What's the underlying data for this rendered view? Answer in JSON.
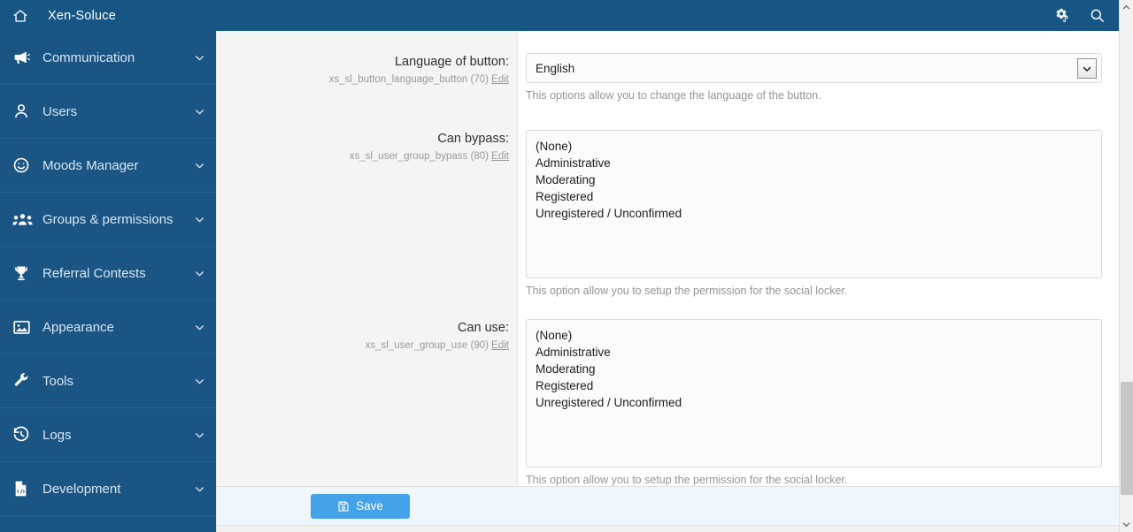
{
  "topbar": {
    "home_icon": "home-icon",
    "title": "Xen-Soluce",
    "gears_icon": "gears-icon",
    "search_icon": "search-icon"
  },
  "sidebar": {
    "items": [
      {
        "label": "Communication",
        "icon": "megaphone-icon",
        "chevron": "chevron-down-icon"
      },
      {
        "label": "Users",
        "icon": "user-icon",
        "chevron": "chevron-down-icon"
      },
      {
        "label": "Moods Manager",
        "icon": "smiley-icon",
        "chevron": "chevron-down-icon"
      },
      {
        "label": "Groups & permissions",
        "icon": "users-group-icon",
        "chevron": "chevron-down-icon"
      },
      {
        "label": "Referral Contests",
        "icon": "trophy-icon",
        "chevron": "chevron-down-icon"
      },
      {
        "label": "Appearance",
        "icon": "image-icon",
        "chevron": "chevron-down-icon"
      },
      {
        "label": "Tools",
        "icon": "wrench-icon",
        "chevron": "chevron-down-icon"
      },
      {
        "label": "Logs",
        "icon": "history-icon",
        "chevron": "chevron-down-icon"
      },
      {
        "label": "Development",
        "icon": "file-code-icon",
        "chevron": "chevron-down-icon"
      }
    ]
  },
  "form": {
    "rows": [
      {
        "label": "Language of button:",
        "option_key": "xs_sl_button_language_button (70)",
        "edit_link": "Edit",
        "control": "select",
        "value": "English",
        "hint": "This options allow you to change the language of the button."
      },
      {
        "label": "Can bypass:",
        "option_key": "xs_sl_user_group_bypass (80)",
        "edit_link": "Edit",
        "control": "listbox",
        "options": [
          "(None)",
          "Administrative",
          "Moderating",
          "Registered",
          "Unregistered / Unconfirmed"
        ],
        "hint": "This option allow you to setup the permission for the social locker."
      },
      {
        "label": "Can use:",
        "option_key": "xs_sl_user_group_use (90)",
        "edit_link": "Edit",
        "control": "listbox",
        "options": [
          "(None)",
          "Administrative",
          "Moderating",
          "Registered",
          "Unregistered / Unconfirmed"
        ],
        "hint": "This option allow you to setup the permission for the social locker."
      }
    ]
  },
  "footer": {
    "save_label": "Save",
    "save_icon": "floppy-disk-icon"
  },
  "scrollbar": {
    "up_icon": "chevron-up-icon",
    "down_icon": "chevron-down-icon"
  },
  "colors": {
    "header_blue": "#165584",
    "sidebar_blue": "#1a5584",
    "save_blue": "#44a3e8",
    "label_bg": "#f4f4f4",
    "savebar_bg": "#eff6fc"
  }
}
